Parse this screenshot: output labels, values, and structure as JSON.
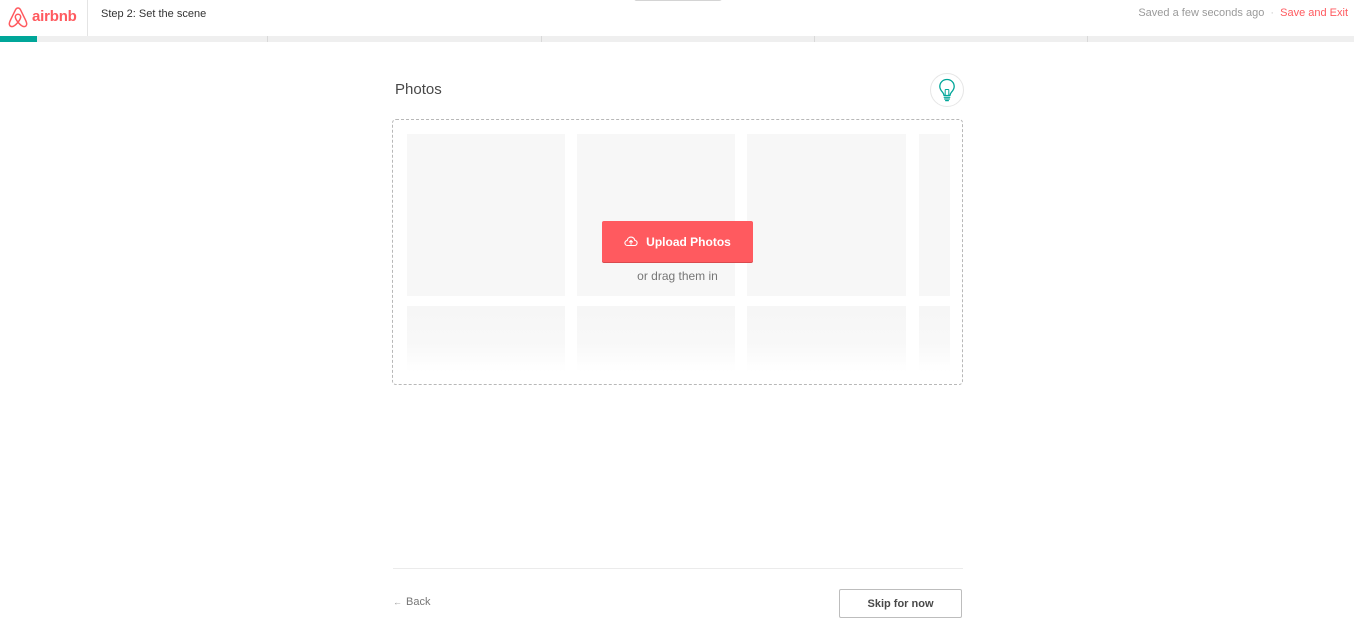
{
  "header": {
    "brand_name": "airbnb",
    "step_title": "Step 2: Set the scene",
    "saved_status": "Saved a few seconds ago",
    "separator": "·",
    "save_exit_label": "Save and Exit"
  },
  "progress": {
    "completed_fraction": 0.027,
    "segment_count": 5
  },
  "photos": {
    "title": "Photos",
    "tip_icon": "lightbulb-icon",
    "upload_label": "Upload Photos",
    "upload_icon": "cloud-upload-icon",
    "drag_hint": "or drag them in"
  },
  "footer": {
    "back_label": "Back",
    "back_icon": "arrow-left-icon",
    "skip_label": "Skip for now"
  },
  "colors": {
    "brand": "#FF5A5F",
    "progress": "#00A699",
    "text": "#484848",
    "muted": "#767676",
    "tip_icon": "#00A699"
  }
}
